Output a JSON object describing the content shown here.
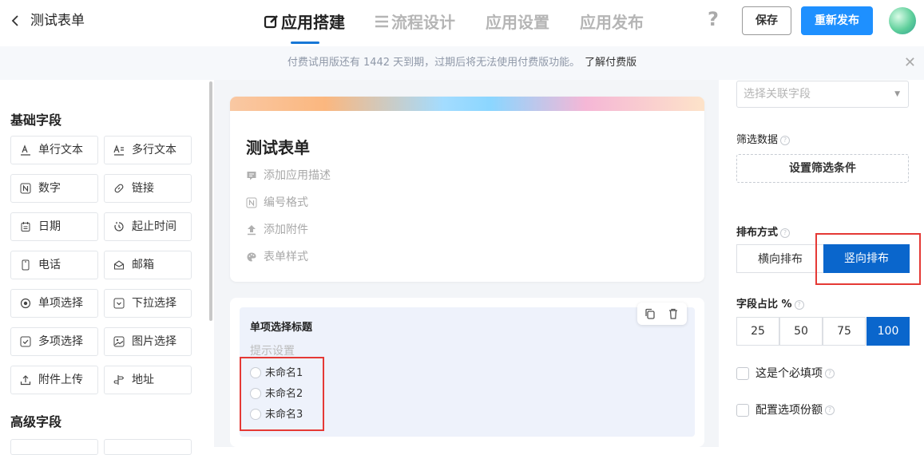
{
  "header": {
    "back_icon": "chevron-left-icon",
    "title": "测试表单",
    "tabs": [
      {
        "label": "应用搭建",
        "icon": "edit-icon",
        "active": true
      },
      {
        "label": "流程设计",
        "icon": "list-icon",
        "active": false
      },
      {
        "label": "应用设置",
        "active": false
      },
      {
        "label": "应用发布",
        "active": false
      }
    ],
    "help_label": "?",
    "save_label": "保存",
    "republish_label": "重新发布",
    "accent": "#1e90ff"
  },
  "notice": {
    "text": "付费试用版还有 1442 天到期，过期后将无法使用付费版功能。",
    "link": "了解付费版",
    "close_label": "✕"
  },
  "left_panel": {
    "basic_title": "基础字段",
    "basic_fields": [
      {
        "label": "单行文本",
        "icon": "single-line-text-icon"
      },
      {
        "label": "多行文本",
        "icon": "multi-line-text-icon"
      },
      {
        "label": "数字",
        "icon": "number-icon"
      },
      {
        "label": "链接",
        "icon": "link-icon"
      },
      {
        "label": "日期",
        "icon": "calendar-icon"
      },
      {
        "label": "起止时间",
        "icon": "time-range-icon"
      },
      {
        "label": "电话",
        "icon": "phone-icon"
      },
      {
        "label": "邮箱",
        "icon": "mail-icon"
      },
      {
        "label": "单项选择",
        "icon": "radio-icon"
      },
      {
        "label": "下拉选择",
        "icon": "dropdown-icon"
      },
      {
        "label": "多项选择",
        "icon": "checkbox-icon"
      },
      {
        "label": "图片选择",
        "icon": "image-icon"
      },
      {
        "label": "附件上传",
        "icon": "upload-icon"
      },
      {
        "label": "地址",
        "icon": "address-icon"
      }
    ],
    "advanced_title": "高级字段"
  },
  "form": {
    "title": "测试表单",
    "options": [
      {
        "label": "添加应用描述",
        "icon": "comment-icon"
      },
      {
        "label": "编号格式",
        "icon": "number-format-icon"
      },
      {
        "label": "添加附件",
        "icon": "attachment-upload-icon"
      },
      {
        "label": "表单样式",
        "icon": "palette-icon"
      }
    ],
    "question": {
      "title": "单项选择标题",
      "hint": "提示设置",
      "choices": [
        "未命名1",
        "未命名2",
        "未命名3"
      ]
    }
  },
  "right_panel": {
    "select_placeholder": "选择关联字段",
    "filter_label": "筛选数据",
    "filter_button": "设置筛选条件",
    "layout_label": "排布方式",
    "layout_options": [
      "横向排布",
      "竖向排布"
    ],
    "layout_selected": "竖向排布",
    "ratio_label": "字段占比 %",
    "ratio_options": [
      "25",
      "50",
      "75",
      "100"
    ],
    "ratio_selected": "100",
    "required_label": "这是个必填项",
    "option_score_label": "配置选项份额",
    "selected_color": "#0a66cc"
  }
}
